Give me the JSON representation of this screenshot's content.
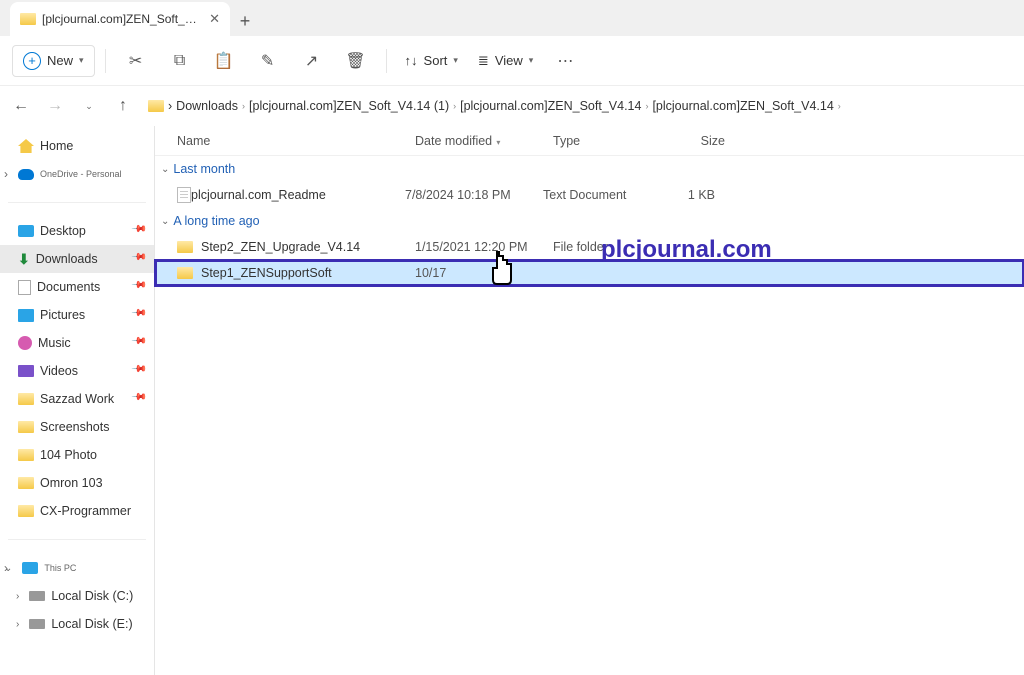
{
  "tab": {
    "title": "[plcjournal.com]ZEN_Soft_V4..."
  },
  "toolbar": {
    "new_label": "New",
    "sort_label": "Sort",
    "view_label": "View"
  },
  "breadcrumb": {
    "items": [
      "Downloads",
      "[plcjournal.com]ZEN_Soft_V4.14 (1)",
      "[plcjournal.com]ZEN_Soft_V4.14",
      "[plcjournal.com]ZEN_Soft_V4.14"
    ]
  },
  "sidebar": {
    "home": "Home",
    "onedrive": "OneDrive - Personal",
    "quick": [
      "Desktop",
      "Downloads",
      "Documents",
      "Pictures",
      "Music",
      "Videos",
      "Sazzad Work",
      "Screenshots",
      "104 Photo",
      "Omron 103",
      "CX-Programmer"
    ],
    "thispc": "This PC",
    "drives": [
      "Local Disk (C:)",
      "Local Disk (E:)"
    ]
  },
  "columns": {
    "name": "Name",
    "date": "Date modified",
    "type": "Type",
    "size": "Size"
  },
  "groups": {
    "last_month": "Last month",
    "long_ago": "A long time ago"
  },
  "files": {
    "readme": {
      "name": "plcjournal.com_Readme",
      "date": "7/8/2024 10:18 PM",
      "type": "Text Document",
      "size": "1 KB"
    },
    "step2": {
      "name": "Step2_ZEN_Upgrade_V4.14",
      "date": "1/15/2021 12:20 PM",
      "type": "File folder",
      "size": ""
    },
    "step1": {
      "name": "Step1_ZENSupportSoft",
      "date": "10/17",
      "type": "",
      "size": ""
    }
  },
  "watermark": "plcjournal.com"
}
